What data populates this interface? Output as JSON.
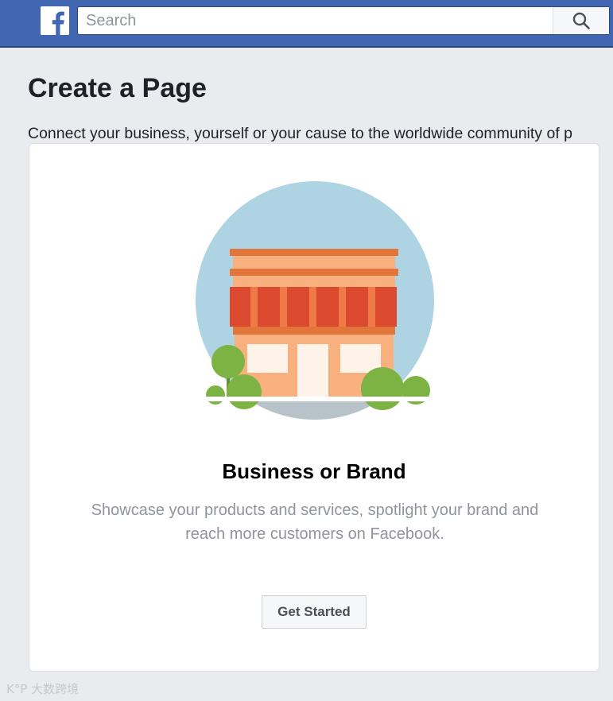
{
  "header": {
    "logo_icon": "facebook-f-icon",
    "search": {
      "placeholder": "Search",
      "button_icon": "search-icon"
    },
    "colors": {
      "bar": "#4267b2",
      "border": "#29487d"
    }
  },
  "main": {
    "title": "Create a Page",
    "subtitle": "Connect your business, yourself or your cause to the worldwide community of p",
    "card": {
      "illustration_icon": "storefront-illustration",
      "title": "Business or Brand",
      "description": "Showcase your products and services, spotlight your brand and reach more customers on Facebook.",
      "button_label": "Get Started"
    }
  },
  "watermark": "K°P 大数跨境"
}
